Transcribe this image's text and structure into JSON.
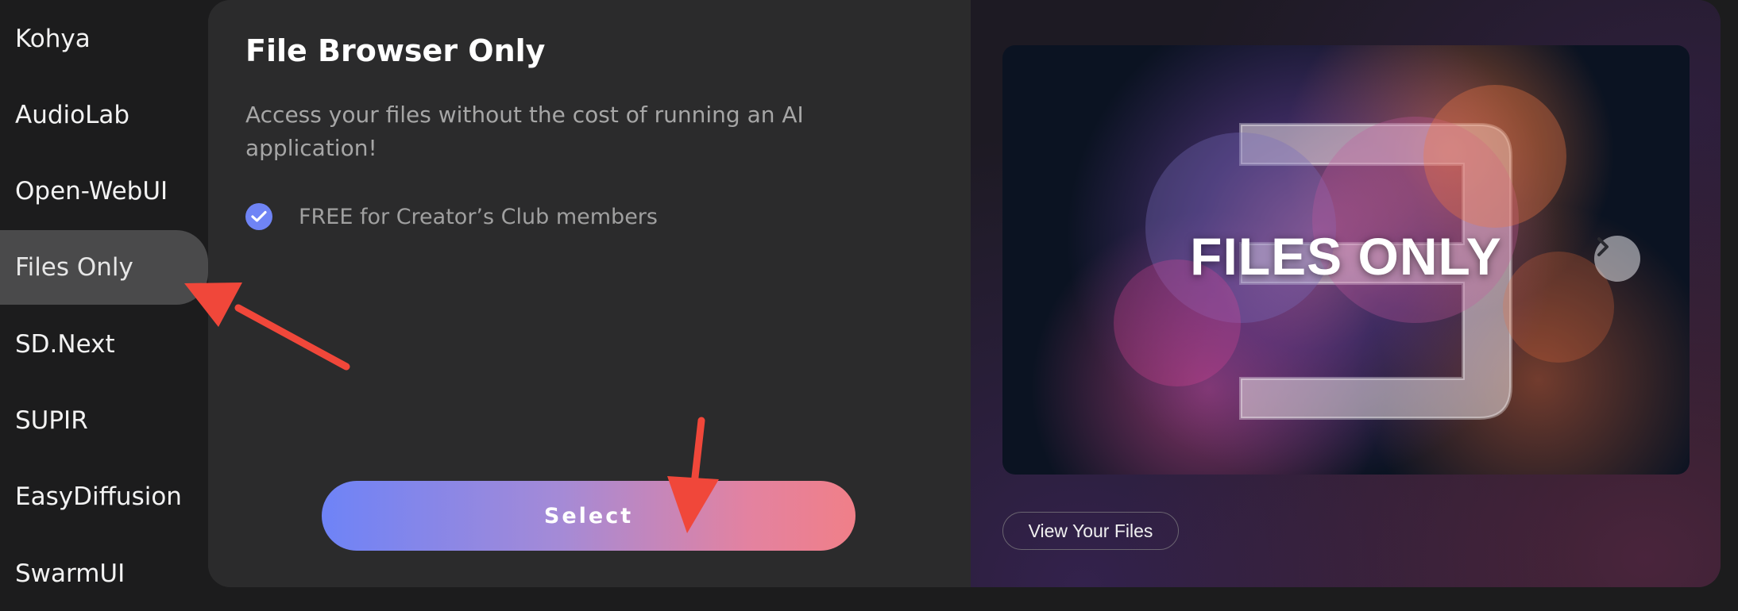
{
  "sidebar": {
    "items": [
      {
        "label": "Kohya"
      },
      {
        "label": "AudioLab"
      },
      {
        "label": "Open-WebUI"
      },
      {
        "label": "Files Only",
        "active": true
      },
      {
        "label": "SD.Next"
      },
      {
        "label": "SUPIR"
      },
      {
        "label": "EasyDiffusion"
      },
      {
        "label": "SwarmUI"
      }
    ]
  },
  "card": {
    "title": "File Browser Only",
    "description": "Access your files without the cost of running an AI application!",
    "features": [
      {
        "icon": "check-circle-icon",
        "text": "FREE for Creator’s Club members"
      }
    ],
    "select_label": "Select"
  },
  "preview": {
    "image_text": "FILES ONLY",
    "next_icon": "chevron-right-icon",
    "view_files_label": "View Your Files"
  },
  "colors": {
    "accent_blue": "#6f84f5",
    "gradient_start": "#6e83f7",
    "gradient_end": "#f07f88",
    "annotation_red": "#f0473a"
  }
}
